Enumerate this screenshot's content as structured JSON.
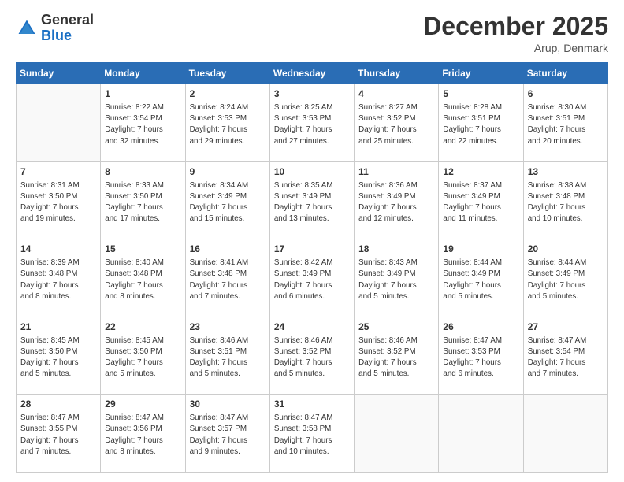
{
  "logo": {
    "general": "General",
    "blue": "Blue"
  },
  "header": {
    "month": "December 2025",
    "location": "Arup, Denmark"
  },
  "weekdays": [
    "Sunday",
    "Monday",
    "Tuesday",
    "Wednesday",
    "Thursday",
    "Friday",
    "Saturday"
  ],
  "weeks": [
    [
      {
        "day": "",
        "info": ""
      },
      {
        "day": "1",
        "info": "Sunrise: 8:22 AM\nSunset: 3:54 PM\nDaylight: 7 hours\nand 32 minutes."
      },
      {
        "day": "2",
        "info": "Sunrise: 8:24 AM\nSunset: 3:53 PM\nDaylight: 7 hours\nand 29 minutes."
      },
      {
        "day": "3",
        "info": "Sunrise: 8:25 AM\nSunset: 3:53 PM\nDaylight: 7 hours\nand 27 minutes."
      },
      {
        "day": "4",
        "info": "Sunrise: 8:27 AM\nSunset: 3:52 PM\nDaylight: 7 hours\nand 25 minutes."
      },
      {
        "day": "5",
        "info": "Sunrise: 8:28 AM\nSunset: 3:51 PM\nDaylight: 7 hours\nand 22 minutes."
      },
      {
        "day": "6",
        "info": "Sunrise: 8:30 AM\nSunset: 3:51 PM\nDaylight: 7 hours\nand 20 minutes."
      }
    ],
    [
      {
        "day": "7",
        "info": "Sunrise: 8:31 AM\nSunset: 3:50 PM\nDaylight: 7 hours\nand 19 minutes."
      },
      {
        "day": "8",
        "info": "Sunrise: 8:33 AM\nSunset: 3:50 PM\nDaylight: 7 hours\nand 17 minutes."
      },
      {
        "day": "9",
        "info": "Sunrise: 8:34 AM\nSunset: 3:49 PM\nDaylight: 7 hours\nand 15 minutes."
      },
      {
        "day": "10",
        "info": "Sunrise: 8:35 AM\nSunset: 3:49 PM\nDaylight: 7 hours\nand 13 minutes."
      },
      {
        "day": "11",
        "info": "Sunrise: 8:36 AM\nSunset: 3:49 PM\nDaylight: 7 hours\nand 12 minutes."
      },
      {
        "day": "12",
        "info": "Sunrise: 8:37 AM\nSunset: 3:49 PM\nDaylight: 7 hours\nand 11 minutes."
      },
      {
        "day": "13",
        "info": "Sunrise: 8:38 AM\nSunset: 3:48 PM\nDaylight: 7 hours\nand 10 minutes."
      }
    ],
    [
      {
        "day": "14",
        "info": "Sunrise: 8:39 AM\nSunset: 3:48 PM\nDaylight: 7 hours\nand 8 minutes."
      },
      {
        "day": "15",
        "info": "Sunrise: 8:40 AM\nSunset: 3:48 PM\nDaylight: 7 hours\nand 8 minutes."
      },
      {
        "day": "16",
        "info": "Sunrise: 8:41 AM\nSunset: 3:48 PM\nDaylight: 7 hours\nand 7 minutes."
      },
      {
        "day": "17",
        "info": "Sunrise: 8:42 AM\nSunset: 3:49 PM\nDaylight: 7 hours\nand 6 minutes."
      },
      {
        "day": "18",
        "info": "Sunrise: 8:43 AM\nSunset: 3:49 PM\nDaylight: 7 hours\nand 5 minutes."
      },
      {
        "day": "19",
        "info": "Sunrise: 8:44 AM\nSunset: 3:49 PM\nDaylight: 7 hours\nand 5 minutes."
      },
      {
        "day": "20",
        "info": "Sunrise: 8:44 AM\nSunset: 3:49 PM\nDaylight: 7 hours\nand 5 minutes."
      }
    ],
    [
      {
        "day": "21",
        "info": "Sunrise: 8:45 AM\nSunset: 3:50 PM\nDaylight: 7 hours\nand 5 minutes."
      },
      {
        "day": "22",
        "info": "Sunrise: 8:45 AM\nSunset: 3:50 PM\nDaylight: 7 hours\nand 5 minutes."
      },
      {
        "day": "23",
        "info": "Sunrise: 8:46 AM\nSunset: 3:51 PM\nDaylight: 7 hours\nand 5 minutes."
      },
      {
        "day": "24",
        "info": "Sunrise: 8:46 AM\nSunset: 3:52 PM\nDaylight: 7 hours\nand 5 minutes."
      },
      {
        "day": "25",
        "info": "Sunrise: 8:46 AM\nSunset: 3:52 PM\nDaylight: 7 hours\nand 5 minutes."
      },
      {
        "day": "26",
        "info": "Sunrise: 8:47 AM\nSunset: 3:53 PM\nDaylight: 7 hours\nand 6 minutes."
      },
      {
        "day": "27",
        "info": "Sunrise: 8:47 AM\nSunset: 3:54 PM\nDaylight: 7 hours\nand 7 minutes."
      }
    ],
    [
      {
        "day": "28",
        "info": "Sunrise: 8:47 AM\nSunset: 3:55 PM\nDaylight: 7 hours\nand 7 minutes."
      },
      {
        "day": "29",
        "info": "Sunrise: 8:47 AM\nSunset: 3:56 PM\nDaylight: 7 hours\nand 8 minutes."
      },
      {
        "day": "30",
        "info": "Sunrise: 8:47 AM\nSunset: 3:57 PM\nDaylight: 7 hours\nand 9 minutes."
      },
      {
        "day": "31",
        "info": "Sunrise: 8:47 AM\nSunset: 3:58 PM\nDaylight: 7 hours\nand 10 minutes."
      },
      {
        "day": "",
        "info": ""
      },
      {
        "day": "",
        "info": ""
      },
      {
        "day": "",
        "info": ""
      }
    ]
  ]
}
